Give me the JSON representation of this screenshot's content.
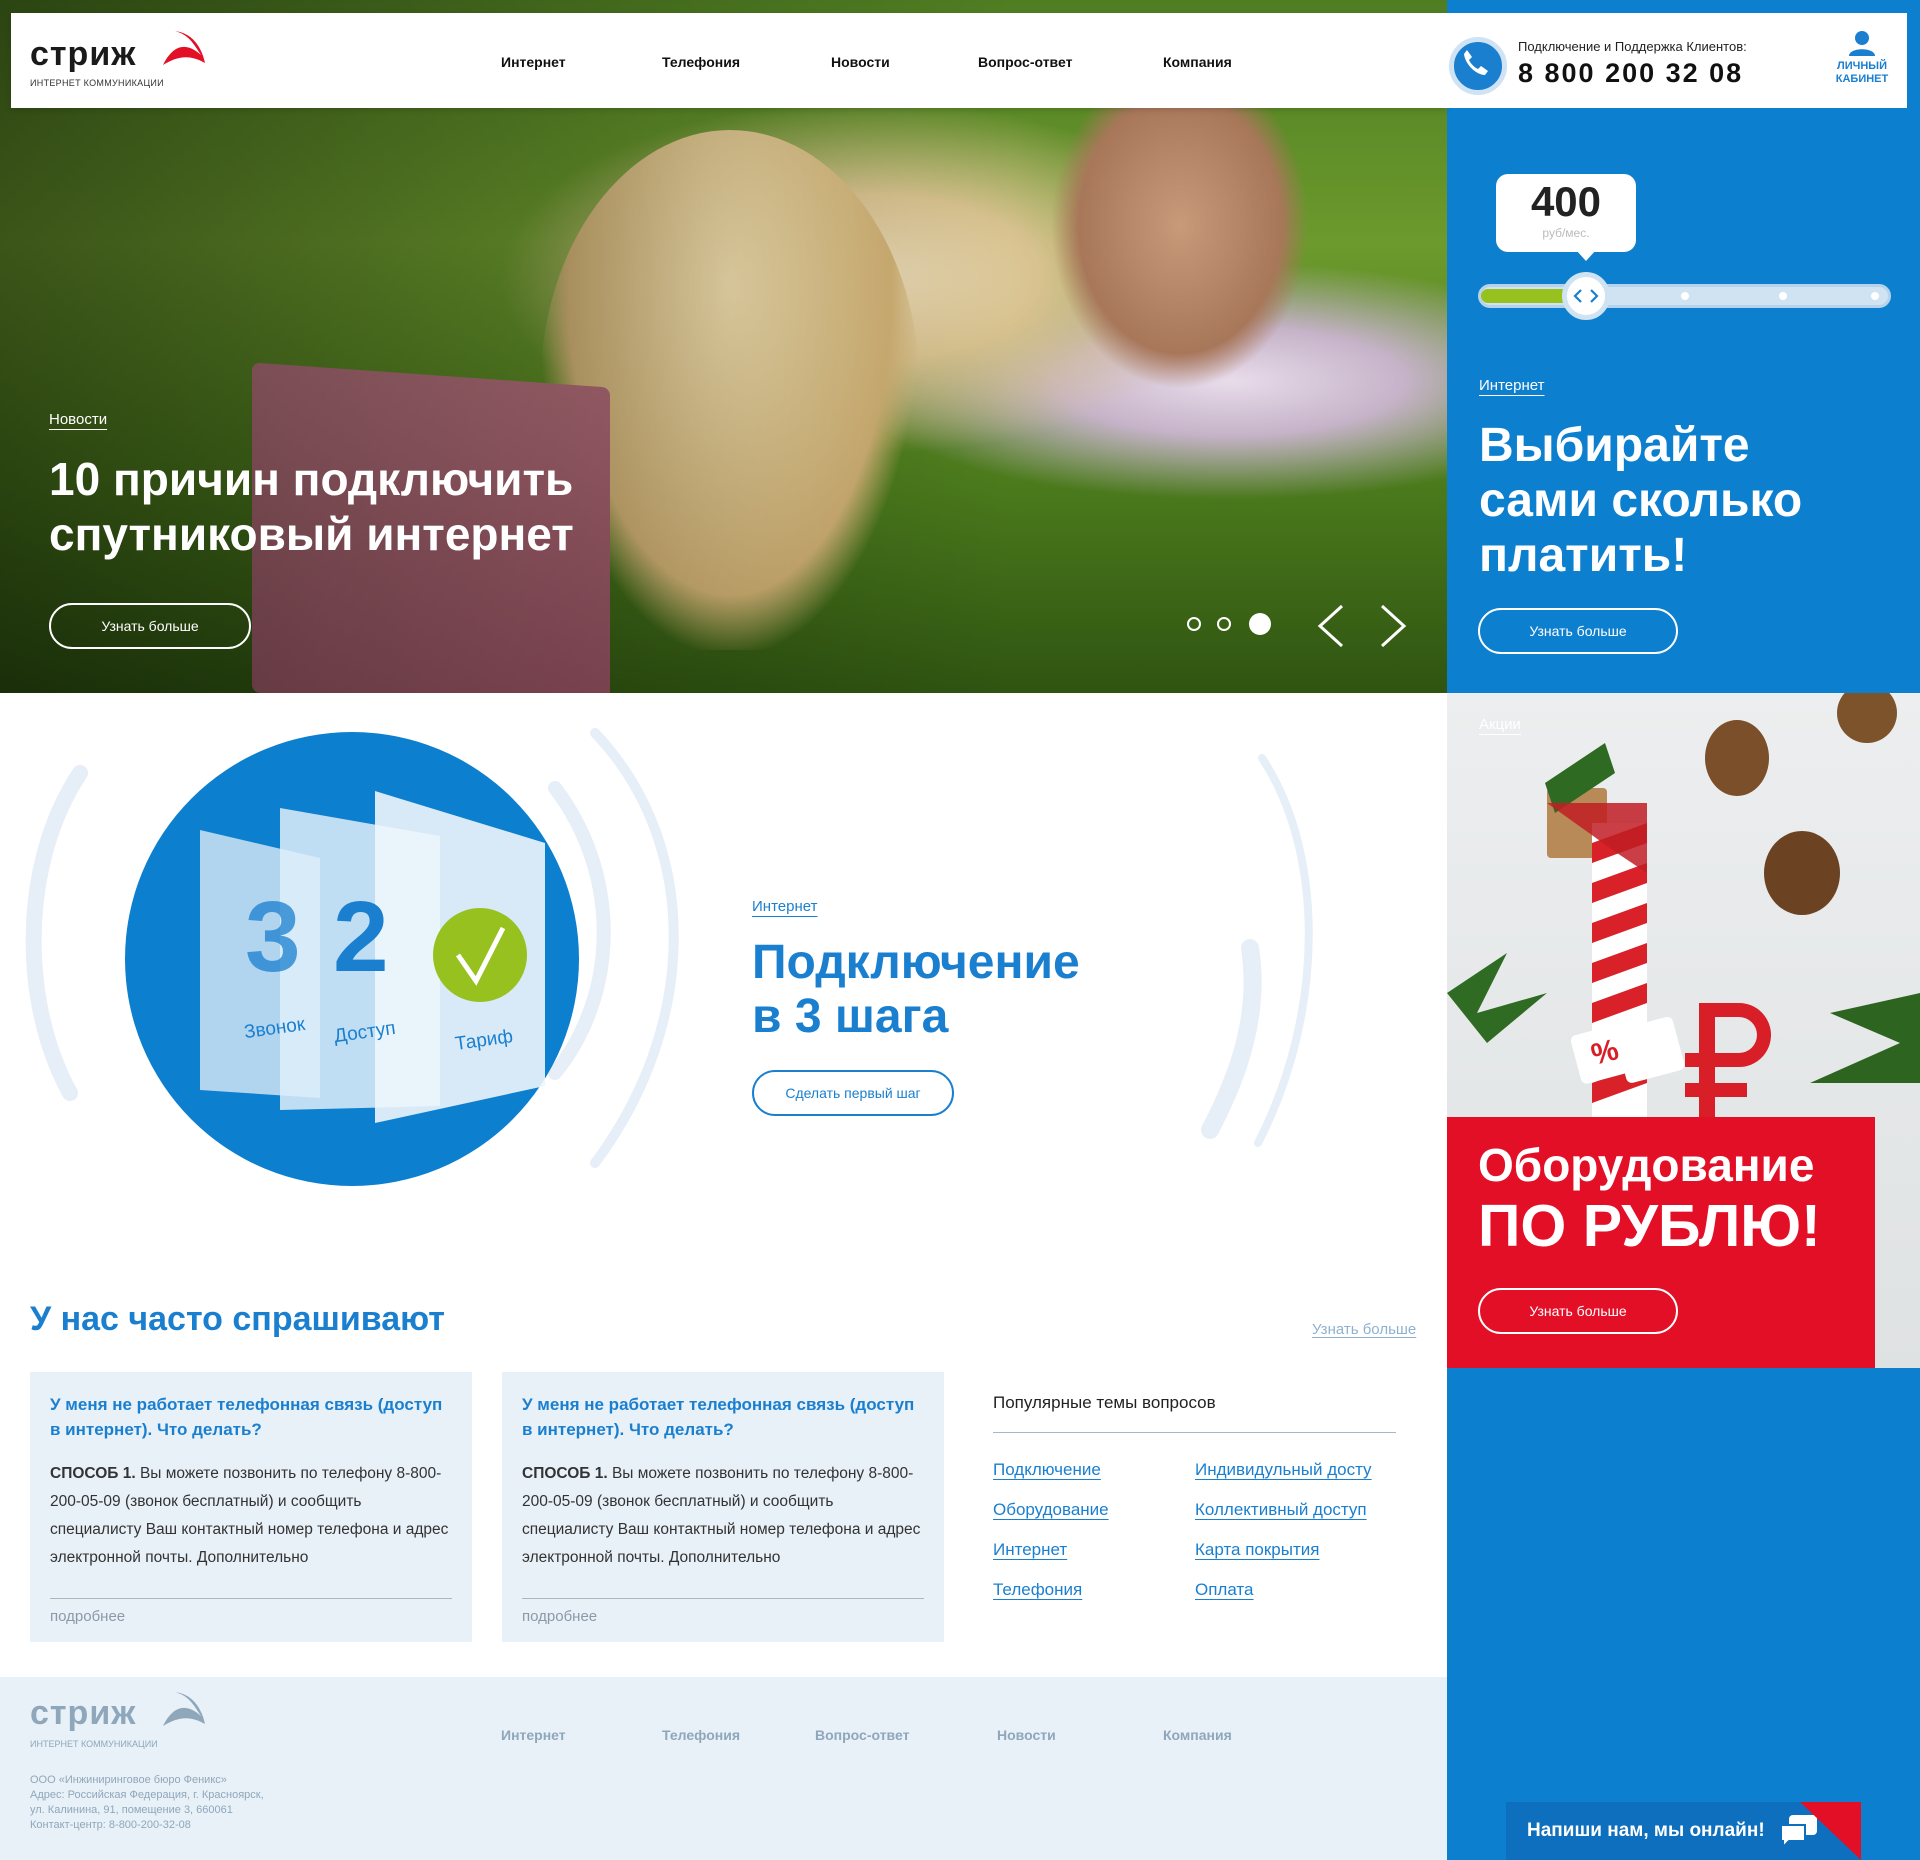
{
  "brand": {
    "name": "стриж",
    "tagline": "ИНТЕРНЕТ КОММУНИКАЦИИ",
    "accent": "#0d7fcf",
    "red": "#e30f27",
    "green": "#96c11f"
  },
  "nav": [
    "Интернет",
    "Телефония",
    "Новости",
    "Вопрос-ответ",
    "Компания"
  ],
  "support": {
    "label": "Подключение и Поддержка Клиентов:",
    "phone": "8 800 200 32 08",
    "icon": "phone-icon"
  },
  "cabinet": {
    "line1": "ЛИЧНЫЙ",
    "line2": "КАБИНЕТ",
    "icon": "user-icon"
  },
  "hero": {
    "tag": "Новости",
    "title_line1": "10 причин подключить",
    "title_line2": "спутниковый интернет",
    "button": "Узнать больше",
    "slides_total": 3,
    "active_slide": 3
  },
  "tariff": {
    "price": "400",
    "unit": "руб/мес.",
    "slider_level": 0.26,
    "tag": "Интернет",
    "title_line1": "Выбирайте",
    "title_line2": "сами сколько",
    "title_line3": "платить!",
    "button": "Узнать больше"
  },
  "promo": {
    "tag": "Акции",
    "title_line1": "Оборудование",
    "title_line2": "ПО РУБЛЮ!",
    "button": "Узнать больше",
    "badge": "%",
    "currency": "₽"
  },
  "steps": {
    "numbers": [
      "3",
      "2"
    ],
    "labels": [
      "Звонок",
      "Доступ",
      "Тариф"
    ],
    "tag": "Интернет",
    "title_line1": "Подключение",
    "title_line2": "в 3 шага",
    "button": "Сделать первый шаг"
  },
  "faq": {
    "title": "У нас часто спрашивают",
    "more_link": "Узнать больше",
    "cards": [
      {
        "question": "У меня не работает телефонная связь (доступ в интернет). Что делать?",
        "answer_bold": "СПОСОБ 1.",
        "answer": " Вы можете позвонить по телефону 8-800-200-05-09 (звонок бесплатный) и сообщить специалисту Ваш контактный номер телефона и адрес электронной почты. Дополнительно",
        "more": "подробнее"
      },
      {
        "question": "У меня не работает телефонная связь (доступ в интернет). Что делать?",
        "answer_bold": "СПОСОБ 1.",
        "answer": " Вы можете позвонить по телефону 8-800-200-05-09 (звонок бесплатный) и сообщить специалисту Ваш контактный номер телефона и адрес электронной почты. Дополнительно",
        "more": "подробнее"
      }
    ],
    "topics_title": "Популярные темы вопросов",
    "topics_col1": [
      "Подключение",
      "Оборудование",
      "Интернет",
      "Телефония"
    ],
    "topics_col2": [
      "Индивидульный досту",
      "Коллективный доступ",
      "Карта покрытия",
      "Оплата"
    ]
  },
  "footer": {
    "nav": [
      "Интернет",
      "Телефония",
      "Вопрос-ответ",
      "Новости",
      "Компания"
    ],
    "address": [
      "ООО «Инжиниринговое бюро Феникс»",
      "Адрес: Российская Федерация, г. Красноярск,",
      "ул. Калинина, 91, помещение 3, 660061",
      "Контакт-центр: 8-800-200-32-08"
    ]
  },
  "chat": {
    "label": "Напиши нам, мы онлайн!",
    "icon": "chat-icon"
  }
}
